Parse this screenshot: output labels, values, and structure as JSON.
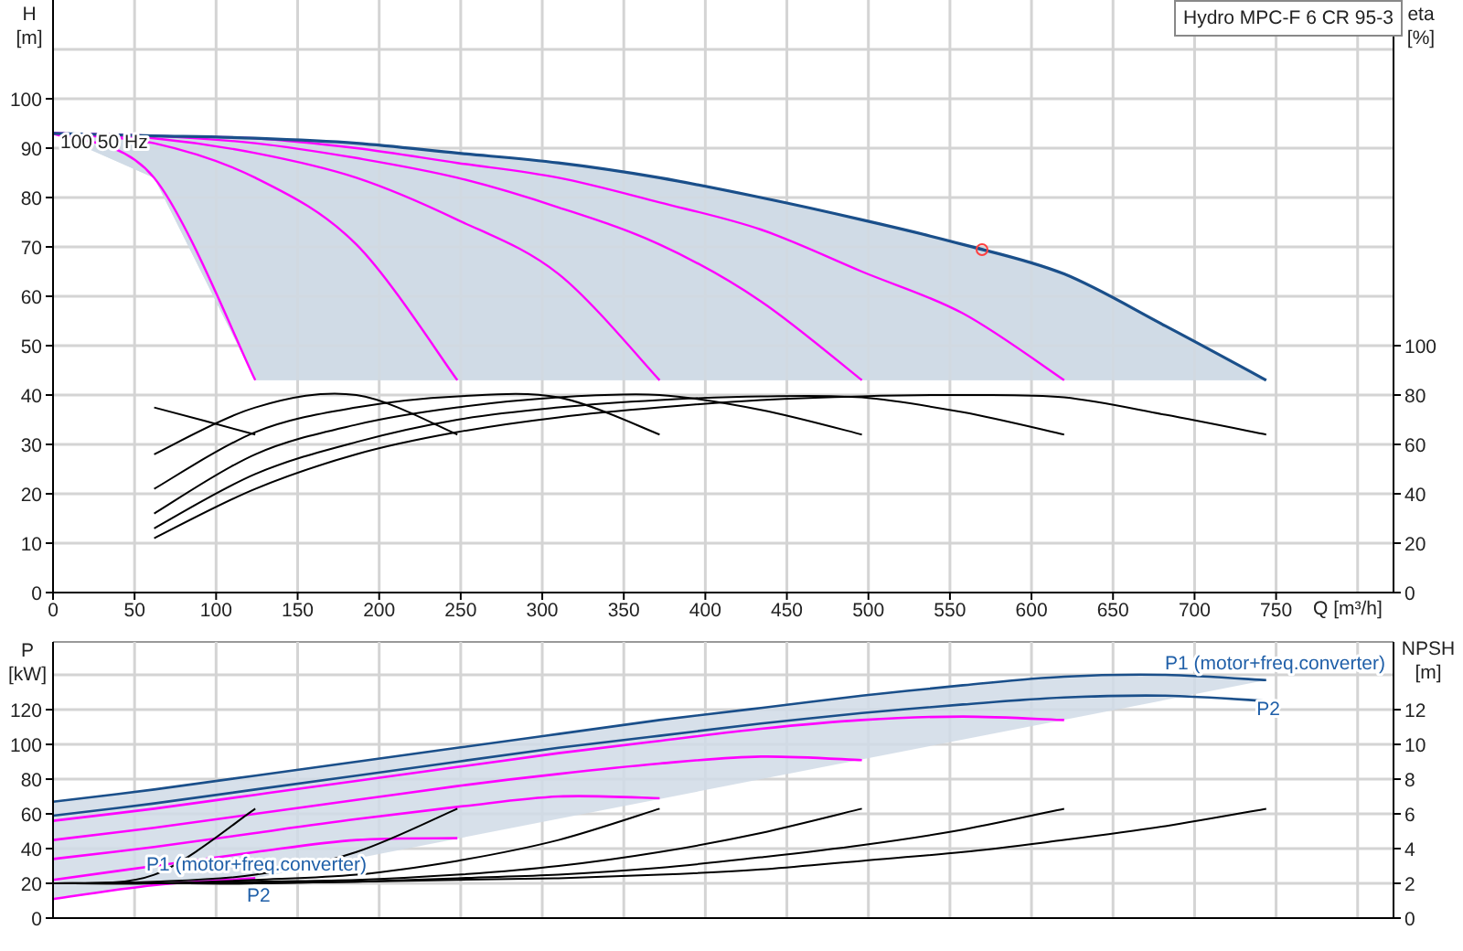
{
  "legend": {
    "title": "Hydro MPC-F 6 CR 95-3"
  },
  "head_chart": {
    "chart_data": {
      "type": "line",
      "xlabel": "Q [m³/h]",
      "ylabel": "H [m]",
      "grid": true,
      "x": [
        0,
        62,
        124,
        186,
        248,
        310,
        372,
        434,
        496,
        558,
        620,
        682,
        744
      ],
      "series": [
        {
          "color": "#ff00ff",
          "values": [
            93,
            84,
            43,
            null,
            null,
            null,
            null,
            null,
            null,
            null,
            null,
            null,
            null
          ]
        },
        {
          "color": "#ff00ff",
          "values": [
            93,
            91,
            84,
            70.5,
            43,
            null,
            null,
            null,
            null,
            null,
            null,
            null,
            null
          ]
        },
        {
          "color": "#ff00ff",
          "values": [
            93,
            92,
            89,
            84,
            75.5,
            64.5,
            43,
            null,
            null,
            null,
            null,
            null,
            null
          ]
        },
        {
          "color": "#ff00ff",
          "values": [
            93,
            92.5,
            91,
            88,
            84,
            78,
            70.5,
            59,
            43,
            null,
            null,
            null,
            null
          ]
        },
        {
          "color": "#ff00ff",
          "values": [
            93,
            92.5,
            92,
            90,
            87,
            84,
            79,
            73.5,
            65,
            56.5,
            43,
            null,
            null
          ]
        },
        {
          "color": "#1a4f8a",
          "values": [
            93,
            92.5,
            92,
            91,
            89,
            87,
            84,
            80,
            75.5,
            70.5,
            64.5,
            54,
            43
          ]
        }
      ],
      "xlim": [
        0,
        822
      ],
      "ylim": [
        0,
        120
      ],
      "xticks": [
        0,
        50,
        100,
        150,
        200,
        250,
        300,
        350,
        400,
        450,
        500,
        550,
        600,
        650,
        700,
        750
      ],
      "yticks": [
        0,
        10,
        20,
        30,
        40,
        50,
        60,
        70,
        80,
        90,
        100
      ],
      "annotations": [
        "100 50 Hz"
      ]
    }
  },
  "efficiency_chart": {
    "chart_data": {
      "type": "line",
      "ylabel": "eta [%]",
      "x": [
        62,
        124,
        186,
        248,
        310,
        372,
        434,
        496,
        558,
        620,
        682,
        744
      ],
      "series": [
        {
          "color": "#000000",
          "values": [
            75,
            64,
            null,
            null,
            null,
            null,
            null,
            null,
            null,
            null,
            null,
            null
          ]
        },
        {
          "color": "#000000",
          "values": [
            56,
            75,
            80,
            64,
            null,
            null,
            null,
            null,
            null,
            null,
            null,
            null
          ]
        },
        {
          "color": "#000000",
          "values": [
            42,
            65,
            75,
            79.5,
            79,
            64,
            null,
            null,
            null,
            null,
            null,
            null
          ]
        },
        {
          "color": "#000000",
          "values": [
            32,
            56,
            68,
            75,
            79,
            80,
            74,
            64,
            null,
            null,
            null,
            null
          ]
        },
        {
          "color": "#000000",
          "values": [
            26,
            48,
            61,
            70,
            75,
            78,
            79.5,
            79,
            73,
            64,
            null,
            null
          ]
        },
        {
          "color": "#000000",
          "values": [
            22,
            42,
            56,
            65,
            71,
            75,
            78,
            79.5,
            80,
            79,
            72,
            64
          ]
        }
      ],
      "xlim": [
        0,
        822
      ],
      "ylim": [
        0,
        240
      ],
      "yticks": [
        0,
        20,
        40,
        60,
        80,
        100
      ]
    }
  },
  "power_chart": {
    "chart_data": {
      "type": "line",
      "ylabel": "P [kW]",
      "grid": true,
      "x": [
        0,
        62,
        124,
        186,
        248,
        310,
        372,
        434,
        496,
        558,
        620,
        682,
        744
      ],
      "series": [
        {
          "color": "#ff00ff",
          "values": [
            11,
            19,
            23,
            null,
            null,
            null,
            null,
            null,
            null,
            null,
            null,
            null,
            null
          ]
        },
        {
          "color": "#ff00ff",
          "values": [
            22,
            30,
            38,
            45,
            46,
            null,
            null,
            null,
            null,
            null,
            null,
            null,
            null
          ]
        },
        {
          "color": "#ff00ff",
          "values": [
            34,
            41,
            49,
            57,
            64,
            70,
            69,
            null,
            null,
            null,
            null,
            null,
            null
          ]
        },
        {
          "color": "#ff00ff",
          "values": [
            45,
            52,
            60,
            68,
            76,
            83,
            89,
            93,
            91,
            null,
            null,
            null,
            null
          ]
        },
        {
          "color": "#ff00ff",
          "values": [
            56,
            63,
            71,
            79,
            87,
            95,
            102,
            109,
            114,
            116,
            114,
            null,
            null
          ]
        },
        {
          "color": "#1a4f8a",
          "values": [
            67,
            74,
            82,
            90,
            98,
            106,
            114,
            121,
            128,
            134,
            139,
            140,
            137
          ]
        },
        {
          "color": "#1a4f8a",
          "values": [
            59,
            66,
            74,
            82,
            90,
            98,
            105,
            112,
            118,
            123,
            127,
            128,
            125
          ]
        }
      ],
      "xlim": [
        0,
        822
      ],
      "ylim": [
        0,
        159
      ],
      "yticks": [
        0,
        20,
        40,
        60,
        80,
        100,
        120
      ],
      "annotations": [
        "P1 (motor+freq.converter)",
        "P2",
        "P1 (motor+freq.converter)",
        "P2"
      ]
    }
  },
  "npsh_chart": {
    "chart_data": {
      "type": "line",
      "ylabel": "NPSH [m]",
      "x": [
        0,
        62,
        124,
        186,
        248,
        310,
        372,
        434,
        496,
        558,
        620,
        682,
        744
      ],
      "series": [
        {
          "color": "#000000",
          "values": [
            2,
            2.5,
            6.3,
            null,
            null,
            null,
            null,
            null,
            null,
            null,
            null,
            null,
            null
          ]
        },
        {
          "color": "#000000",
          "values": [
            2,
            2.1,
            2.5,
            3.8,
            6.3,
            null,
            null,
            null,
            null,
            null,
            null,
            null,
            null
          ]
        },
        {
          "color": "#000000",
          "values": [
            2,
            2,
            2.2,
            2.5,
            3.3,
            4.5,
            6.3,
            null,
            null,
            null,
            null,
            null,
            null
          ]
        },
        {
          "color": "#000000",
          "values": [
            2,
            2,
            2.1,
            2.2,
            2.5,
            3,
            3.8,
            4.9,
            6.3,
            null,
            null,
            null,
            null
          ]
        },
        {
          "color": "#000000",
          "values": [
            2,
            2,
            2,
            2.1,
            2.3,
            2.5,
            2.9,
            3.5,
            4.2,
            5.1,
            6.3,
            null,
            null
          ]
        },
        {
          "color": "#000000",
          "values": [
            2,
            2,
            2,
            2.1,
            2.2,
            2.3,
            2.5,
            2.8,
            3.3,
            3.8,
            4.5,
            5.3,
            6.3
          ]
        }
      ],
      "xlim": [
        0,
        822
      ],
      "ylim": [
        0,
        15.9
      ],
      "yticks": [
        0,
        2,
        4,
        6,
        8,
        10,
        12
      ]
    }
  }
}
